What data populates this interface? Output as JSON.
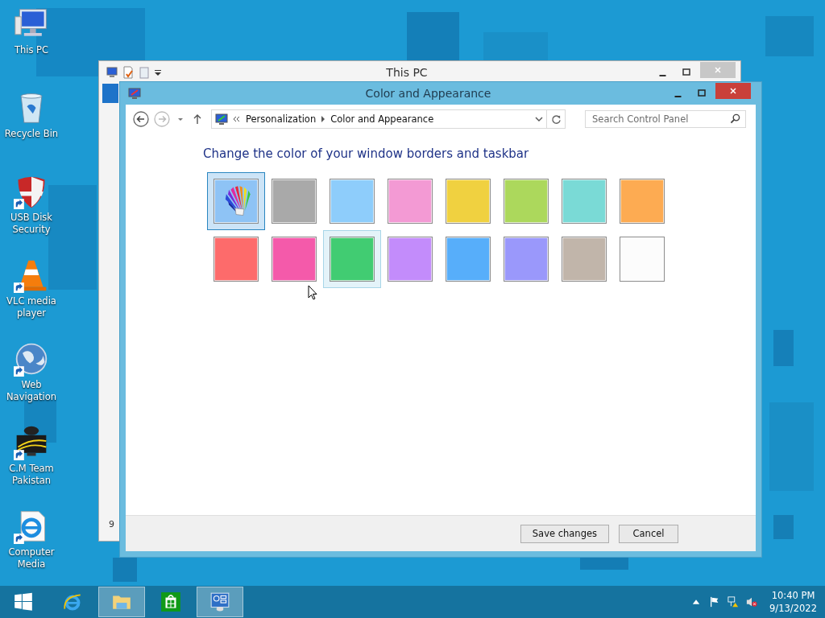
{
  "desktop_icons": [
    {
      "label": "This PC",
      "kind": "pc",
      "shortcut": false
    },
    {
      "label": "Recycle Bin",
      "kind": "bin",
      "shortcut": false
    },
    {
      "label": "USB Disk Security",
      "kind": "shield",
      "shortcut": true
    },
    {
      "label": "VLC media player",
      "kind": "cone",
      "shortcut": true
    },
    {
      "label": "Web Navigation",
      "kind": "globe",
      "shortcut": true
    },
    {
      "label": "C.M Team Pakistan",
      "kind": "cm",
      "shortcut": true
    },
    {
      "label": "Computer Media",
      "kind": "ie",
      "shortcut": true
    }
  ],
  "back_window": {
    "title": "This PC",
    "status_text": "9"
  },
  "window": {
    "title": "Color and Appearance",
    "breadcrumb": [
      {
        "label": "Personalization"
      },
      {
        "label": "Color and Appearance"
      }
    ],
    "search": {
      "placeholder": "Search Control Panel"
    },
    "heading": "Change the color of your window borders and taskbar",
    "swatches": [
      {
        "kind": "auto",
        "selected": true,
        "hovered": false
      },
      {
        "kind": "color",
        "color": "#a9a9a9",
        "selected": false,
        "hovered": false
      },
      {
        "kind": "color",
        "color": "#8ecdfb",
        "selected": false,
        "hovered": false
      },
      {
        "kind": "color",
        "color": "#f39ad4",
        "selected": false,
        "hovered": false
      },
      {
        "kind": "color",
        "color": "#f0d140",
        "selected": false,
        "hovered": false
      },
      {
        "kind": "color",
        "color": "#acd85c",
        "selected": false,
        "hovered": false
      },
      {
        "kind": "color",
        "color": "#7adad6",
        "selected": false,
        "hovered": false
      },
      {
        "kind": "color",
        "color": "#fdab52",
        "selected": false,
        "hovered": false
      },
      {
        "kind": "color",
        "color": "#fd6b6b",
        "selected": false,
        "hovered": false
      },
      {
        "kind": "color",
        "color": "#f45aaa",
        "selected": false,
        "hovered": false
      },
      {
        "kind": "color",
        "color": "#41cc72",
        "selected": false,
        "hovered": true
      },
      {
        "kind": "color",
        "color": "#c38cfb",
        "selected": false,
        "hovered": false
      },
      {
        "kind": "color",
        "color": "#57aefa",
        "selected": false,
        "hovered": false
      },
      {
        "kind": "color",
        "color": "#9a98fb",
        "selected": false,
        "hovered": false
      },
      {
        "kind": "color",
        "color": "#c1b5aa",
        "selected": false,
        "hovered": false
      },
      {
        "kind": "color",
        "color": "#fcfcfc",
        "selected": false,
        "hovered": false
      }
    ],
    "buttons": [
      "Save changes",
      "Cancel"
    ]
  },
  "taskbar": {
    "apps": [
      {
        "kind": "start",
        "active": false
      },
      {
        "kind": "ie",
        "active": false
      },
      {
        "kind": "explorer",
        "active": true
      },
      {
        "kind": "store",
        "active": false
      },
      {
        "kind": "control",
        "active": true
      }
    ],
    "time": "10:40 PM",
    "date": "9/13/2022"
  }
}
